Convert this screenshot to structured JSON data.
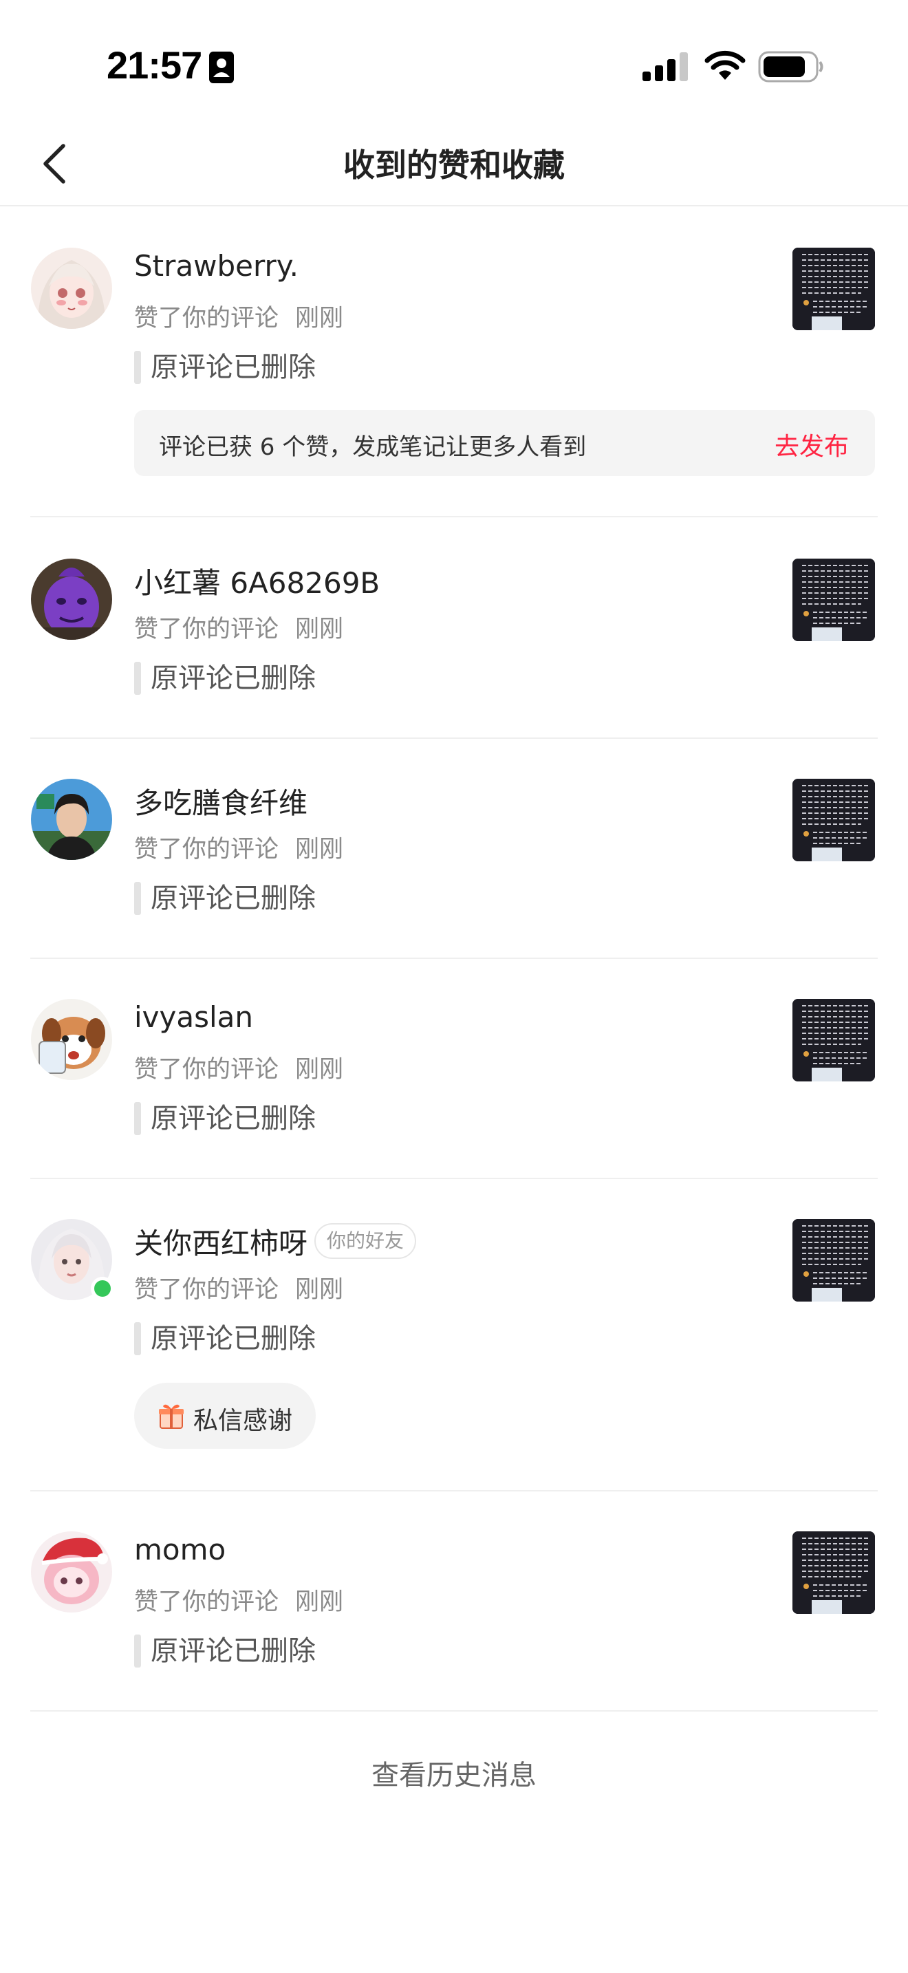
{
  "status_bar": {
    "time": "21:57"
  },
  "nav": {
    "title": "收到的赞和收藏"
  },
  "items": [
    {
      "user": "Strawberry.",
      "action": "赞了你的评论",
      "time": "刚刚",
      "quote": "原评论已删除",
      "promo": {
        "text": "评论已获 6 个赞，发成笔记让更多人看到",
        "action": "去发布"
      }
    },
    {
      "user": "小红薯 6A68269B",
      "action": "赞了你的评论",
      "time": "刚刚",
      "quote": "原评论已删除"
    },
    {
      "user": "多吃膳食纤维",
      "action": "赞了你的评论",
      "time": "刚刚",
      "quote": "原评论已删除"
    },
    {
      "user": "ivyaslan",
      "action": "赞了你的评论",
      "time": "刚刚",
      "quote": "原评论已删除"
    },
    {
      "user": "关你西红柿呀",
      "badge": "你的好友",
      "online": true,
      "action": "赞了你的评论",
      "time": "刚刚",
      "quote": "原评论已删除",
      "thanks_button": "私信感谢"
    },
    {
      "user": "momo",
      "action": "赞了你的评论",
      "time": "刚刚",
      "quote": "原评论已删除"
    }
  ],
  "history_link": "查看历史消息",
  "colors": {
    "accent": "#ff2442",
    "online": "#34c759",
    "divider": "#efefef"
  },
  "icons": {
    "back": "chevron-left-icon",
    "signal": "cellular-signal-icon",
    "wifi": "wifi-icon",
    "battery": "battery-icon",
    "thanks": "gift-icon"
  }
}
